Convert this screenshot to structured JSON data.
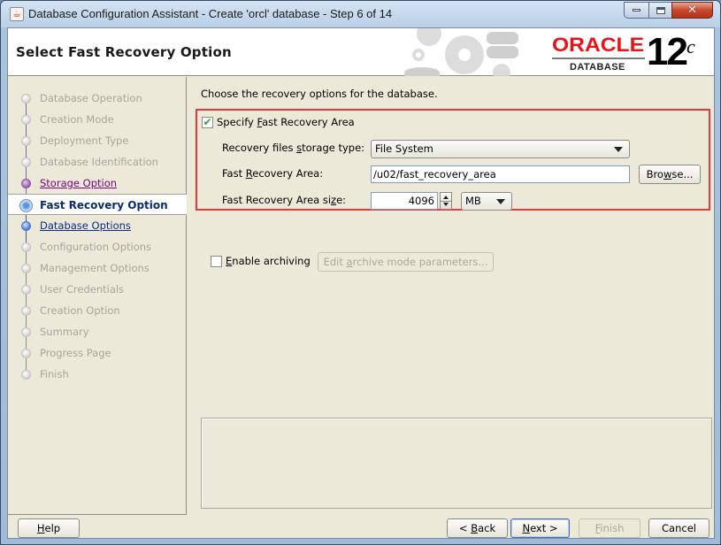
{
  "window": {
    "title": "Database Configuration Assistant - Create 'orcl' database - Step 6 of 14",
    "app_icon": "java-icon",
    "controls": [
      "minimize",
      "maximize",
      "close"
    ]
  },
  "banner": {
    "title": "Select Fast Recovery Option",
    "logo": {
      "brand": "ORACLE",
      "product": "DATABASE",
      "version": "12",
      "version_suffix": "c",
      "brand_color": "#e8141b"
    }
  },
  "sidebar": {
    "steps": [
      {
        "label": "Database Operation",
        "state": "disabled"
      },
      {
        "label": "Creation Mode",
        "state": "disabled"
      },
      {
        "label": "Deployment Type",
        "state": "disabled"
      },
      {
        "label": "Database Identification",
        "state": "disabled"
      },
      {
        "label": "Storage Option",
        "state": "visited"
      },
      {
        "label": "Fast Recovery Option",
        "state": "current"
      },
      {
        "label": "Database Options",
        "state": "link"
      },
      {
        "label": "Configuration Options",
        "state": "disabled"
      },
      {
        "label": "Management Options",
        "state": "disabled"
      },
      {
        "label": "User Credentials",
        "state": "disabled"
      },
      {
        "label": "Creation Option",
        "state": "disabled"
      },
      {
        "label": "Summary",
        "state": "disabled"
      },
      {
        "label": "Progress Page",
        "state": "disabled"
      },
      {
        "label": "Finish",
        "state": "disabled"
      }
    ]
  },
  "content": {
    "intro": "Choose the recovery options for the database.",
    "specify_fra": {
      "label_pre": "Specify ",
      "label_mnemonic": "F",
      "label_post": "ast Recovery Area",
      "checked": true
    },
    "storage_type": {
      "label_pre": "Recovery files ",
      "label_mnemonic": "s",
      "label_post": "torage type:",
      "value": "File System"
    },
    "fra_location": {
      "label_pre": "Fast ",
      "label_mnemonic": "R",
      "label_post": "ecovery Area:",
      "value": "/u02/fast_recovery_area",
      "browse_pre": "Bro",
      "browse_mnemonic": "w",
      "browse_post": "se..."
    },
    "fra_size": {
      "label_pre": "Fast Recovery Area si",
      "label_mnemonic": "z",
      "label_post": "e:",
      "value": "4096",
      "unit": "MB"
    },
    "archiving": {
      "label_mnemonic": "E",
      "label_post": "nable archiving",
      "checked": false,
      "edit_pre": "Edit ",
      "edit_mnemonic": "a",
      "edit_post": "rchive mode parameters..."
    },
    "highlight_color": "#e53a3a"
  },
  "footer": {
    "help": {
      "mnemonic": "H",
      "post": "elp"
    },
    "back": {
      "pre": "< ",
      "mnemonic": "B",
      "post": "ack"
    },
    "next": {
      "mnemonic": "N",
      "post": "ext >"
    },
    "finish": {
      "mnemonic": "F",
      "post": "inish",
      "enabled": false
    },
    "cancel": {
      "label": "Cancel"
    }
  }
}
